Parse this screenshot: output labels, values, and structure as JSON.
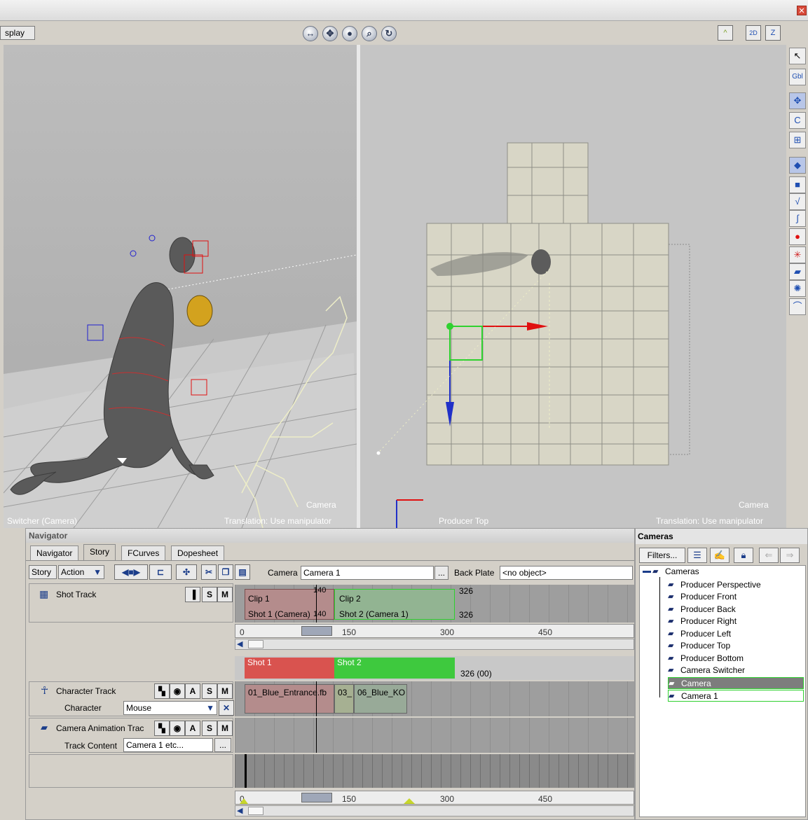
{
  "window": {
    "close_glyph": "✕"
  },
  "viewer": {
    "display_label": "splay",
    "nav_icons": [
      "pan-icon",
      "move-icon",
      "orbit-icon",
      "zoom-icon",
      "reset-icon"
    ],
    "nav_glyphs": [
      "↔",
      "✥",
      "●",
      "⌕",
      "↻"
    ],
    "right_buttons": [
      "^",
      "2D",
      "Z"
    ],
    "right_button_icons": [
      "curve-icon",
      "zoom-2d-icon",
      "draw-icon"
    ]
  },
  "tools": {
    "items": [
      {
        "icon": "select-arrow-icon",
        "glyph": "↖"
      },
      {
        "icon": "global-icon",
        "glyph": "Gbl"
      },
      {
        "icon": "translate-icon",
        "glyph": "✥"
      },
      {
        "icon": "rotate-icon",
        "glyph": "C"
      },
      {
        "icon": "scale-icon",
        "glyph": "⊞"
      },
      {
        "icon": "object-select-icon",
        "glyph": "◆"
      },
      {
        "icon": "cube-icon",
        "glyph": "■"
      },
      {
        "icon": "curve-tool-icon",
        "glyph": "√"
      },
      {
        "icon": "path-tool-icon",
        "glyph": "∫"
      },
      {
        "icon": "record-icon",
        "glyph": "●"
      },
      {
        "icon": "sparkle-icon",
        "glyph": "✳"
      },
      {
        "icon": "camera-tool-icon",
        "glyph": "▰"
      },
      {
        "icon": "light-icon",
        "glyph": "✺"
      },
      {
        "icon": "hook-icon",
        "glyph": "⌒"
      }
    ]
  },
  "viewports": {
    "left": {
      "camera_label": "Camera",
      "name_label": "Switcher (Camera)",
      "status_label": "Translation: Use manipulator"
    },
    "right": {
      "camera_label": "Camera",
      "name_label": "Producer Top",
      "status_label": "Translation: Use manipulator"
    }
  },
  "navigator": {
    "title": "Navigator",
    "tabs": [
      "Navigator",
      "Story",
      "FCurves",
      "Dopesheet"
    ],
    "active_tab": "Story",
    "toolbar": {
      "story_label": "Story",
      "action_label": "Action",
      "camera_label": "Camera",
      "camera_value": "Camera 1",
      "ellipsis": "...",
      "back_plate_label": "Back Plate",
      "back_plate_value": "<no object>"
    },
    "shot_track": {
      "label": "Shot Track",
      "buttons": [
        "S",
        "M"
      ],
      "clip1": {
        "name": "Clip 1",
        "shot": "Shot 1 (Camera)",
        "start": "140",
        "end": "140"
      },
      "clip2": {
        "name": "Clip 2",
        "shot": "Shot 2 (Camera 1)",
        "start": "326",
        "end": "326"
      },
      "ruler": [
        "0",
        "150",
        "300",
        "450"
      ]
    },
    "shots_bar": {
      "shot1": "Shot 1",
      "shot2": "Shot 2",
      "end_label": "326 (00)"
    },
    "character_track": {
      "label": "Character Track",
      "buttons": [
        "A",
        "S",
        "M"
      ],
      "character_label": "Character",
      "character_value": "Mouse",
      "clips": [
        "01_Blue_Entrance.fb",
        "03_",
        "06_Blue_KO"
      ]
    },
    "camera_track": {
      "label": "Camera Animation Trac",
      "buttons": [
        "A",
        "S",
        "M"
      ],
      "content_label": "Track Content",
      "content_value": "Camera 1 etc...",
      "ellipsis": "..."
    },
    "bottom_ruler": [
      "0",
      "150",
      "300",
      "450"
    ],
    "scroll_mark": "|||"
  },
  "cameras": {
    "title": "Cameras",
    "filters_label": "Filters...",
    "root": "Cameras",
    "items": [
      "Producer Perspective",
      "Producer Front",
      "Producer Back",
      "Producer Right",
      "Producer Left",
      "Producer Top",
      "Producer Bottom",
      "Camera Switcher",
      "Camera",
      "Camera 1"
    ],
    "selected": "Camera"
  },
  "colors": {
    "shot1": "#d9534f",
    "shot2": "#3ec93e",
    "clip_fill": "#b48c8c",
    "accent": "#2fd12f"
  }
}
